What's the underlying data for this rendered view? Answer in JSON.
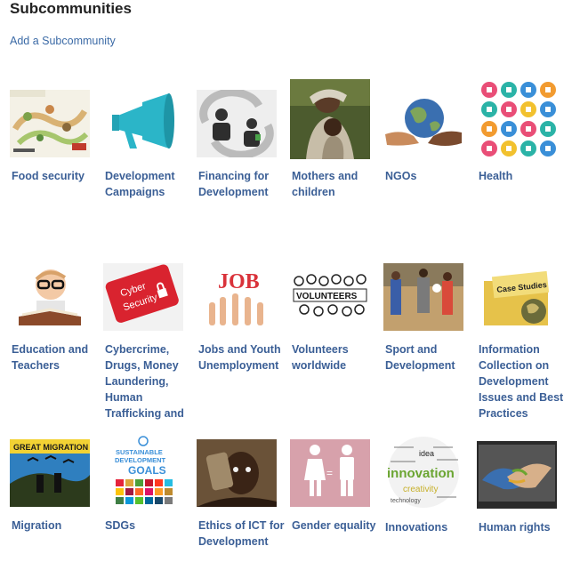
{
  "page": {
    "title": "Subcommunities",
    "add_link": "Add a Subcommunity"
  },
  "subcommunities": [
    {
      "label": "Food security",
      "icon": "food-security-infographic"
    },
    {
      "label": "Development Campaigns",
      "icon": "megaphone"
    },
    {
      "label": "Financing for Development",
      "icon": "people-exchange"
    },
    {
      "label": "Mothers and children",
      "icon": "mother-and-child-photo"
    },
    {
      "label": "NGOs",
      "icon": "hands-holding-globe"
    },
    {
      "label": "Health",
      "icon": "health-icons-grid"
    },
    {
      "label": "Education and Teachers",
      "icon": "child-reading-book"
    },
    {
      "label": "Cybercrime, Drugs, Money Laundering, Human Trafficking and",
      "icon": "cyber-security-key"
    },
    {
      "label": "Jobs and Youth Unemployment",
      "icon": "job-hands"
    },
    {
      "label": "Volunteers worldwide",
      "icon": "volunteers-sketch"
    },
    {
      "label": "Sport and Development",
      "icon": "football-players-photo"
    },
    {
      "label": "Information Collection on Development Issues and Best Practices",
      "icon": "case-studies-folder"
    },
    {
      "label": "Migration",
      "icon": "great-migration-poster"
    },
    {
      "label": "SDGs",
      "icon": "sdg-goals-logo"
    },
    {
      "label": "Ethics of ICT for Development",
      "icon": "child-with-device-photo"
    },
    {
      "label": "Gender equality",
      "icon": "gender-equality-sign"
    },
    {
      "label": "Innovations",
      "icon": "innovation-word-cloud"
    },
    {
      "label": "Human rights",
      "icon": "painted-handshake"
    }
  ],
  "thumb_text": {
    "cyber_top": "Cyber",
    "cyber_bottom": "Security",
    "job": "JOB",
    "volunteers": "VOLUNTEERS",
    "case_studies": "Case Studies",
    "migration": "GREAT MIGRATION",
    "sdg_top": "SUSTAINABLE",
    "sdg_mid": "DEVELOPMENT",
    "sdg_goals": "GOALS",
    "innovation": "innovation",
    "idea": "idea",
    "creativity": "creativity",
    "technology": "technology",
    "equals": "="
  },
  "colors": {
    "link": "#3b5f96",
    "add_link": "#3b6aa6",
    "megaphone": "#2bb5c8",
    "cyber_red": "#d9232f",
    "gender_bg": "#d7a1ab",
    "innovation_green": "#6aa531"
  }
}
